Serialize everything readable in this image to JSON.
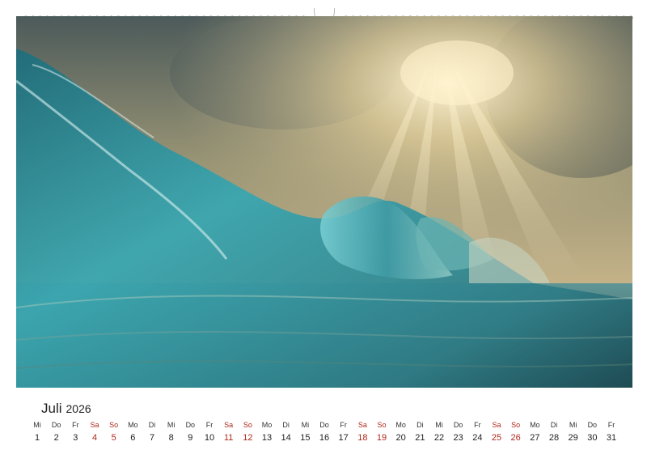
{
  "calendar": {
    "month": "Juli",
    "year": "2026",
    "days": [
      {
        "wd": "Mi",
        "d": "1",
        "we": false
      },
      {
        "wd": "Do",
        "d": "2",
        "we": false
      },
      {
        "wd": "Fr",
        "d": "3",
        "we": false
      },
      {
        "wd": "Sa",
        "d": "4",
        "we": true
      },
      {
        "wd": "So",
        "d": "5",
        "we": true
      },
      {
        "wd": "Mo",
        "d": "6",
        "we": false
      },
      {
        "wd": "Di",
        "d": "7",
        "we": false
      },
      {
        "wd": "Mi",
        "d": "8",
        "we": false
      },
      {
        "wd": "Do",
        "d": "9",
        "we": false
      },
      {
        "wd": "Fr",
        "d": "10",
        "we": false
      },
      {
        "wd": "Sa",
        "d": "11",
        "we": true
      },
      {
        "wd": "So",
        "d": "12",
        "we": true
      },
      {
        "wd": "Mo",
        "d": "13",
        "we": false
      },
      {
        "wd": "Di",
        "d": "14",
        "we": false
      },
      {
        "wd": "Mi",
        "d": "15",
        "we": false
      },
      {
        "wd": "Do",
        "d": "16",
        "we": false
      },
      {
        "wd": "Fr",
        "d": "17",
        "we": false
      },
      {
        "wd": "Sa",
        "d": "18",
        "we": true
      },
      {
        "wd": "So",
        "d": "19",
        "we": true
      },
      {
        "wd": "Mo",
        "d": "20",
        "we": false
      },
      {
        "wd": "Di",
        "d": "21",
        "we": false
      },
      {
        "wd": "Mi",
        "d": "22",
        "we": false
      },
      {
        "wd": "Do",
        "d": "23",
        "we": false
      },
      {
        "wd": "Fr",
        "d": "24",
        "we": false
      },
      {
        "wd": "Sa",
        "d": "25",
        "we": true
      },
      {
        "wd": "So",
        "d": "26",
        "we": true
      },
      {
        "wd": "Mo",
        "d": "27",
        "we": false
      },
      {
        "wd": "Di",
        "d": "28",
        "we": false
      },
      {
        "wd": "Mi",
        "d": "29",
        "we": false
      },
      {
        "wd": "Do",
        "d": "30",
        "we": false
      },
      {
        "wd": "Fr",
        "d": "31",
        "we": false
      }
    ]
  },
  "colors": {
    "weekend": "#b0281b",
    "text": "#222222"
  },
  "photo": {
    "icon": "ocean-wave-image"
  }
}
